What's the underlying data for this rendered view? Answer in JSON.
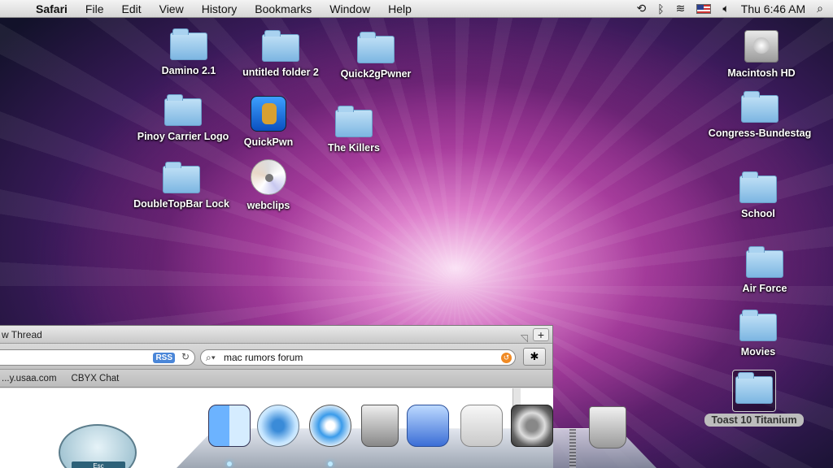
{
  "menubar": {
    "app_name": "Safari",
    "menus": [
      "File",
      "Edit",
      "View",
      "History",
      "Bookmarks",
      "Window",
      "Help"
    ],
    "clock": "Thu 6:46 AM"
  },
  "desktop_icons": [
    {
      "label": "Damino 2.1",
      "kind": "folder"
    },
    {
      "label": "untitled folder 2",
      "kind": "folder"
    },
    {
      "label": "Quick2gPwner",
      "kind": "folder"
    },
    {
      "label": "Macintosh HD",
      "kind": "drive"
    },
    {
      "label": "Pinoy Carrier Logo",
      "kind": "folder"
    },
    {
      "label": "QuickPwn",
      "kind": "app"
    },
    {
      "label": "The Killers",
      "kind": "folder"
    },
    {
      "label": "Congress-Bundestag",
      "kind": "folder"
    },
    {
      "label": "DoubleTopBar Lock",
      "kind": "folder"
    },
    {
      "label": "webclips",
      "kind": "disc"
    },
    {
      "label": "School",
      "kind": "folder"
    },
    {
      "label": "Air Force",
      "kind": "folder"
    },
    {
      "label": "Movies",
      "kind": "folder"
    },
    {
      "label": "Toast 10 Titanium",
      "kind": "folder",
      "selected": true
    }
  ],
  "safari": {
    "title": "w Thread",
    "rss_label": "RSS",
    "search_value": "mac rumors forum",
    "bookmarks": [
      "...y.usaa.com",
      "CBYX Chat"
    ]
  },
  "widget": {
    "key_label": "Esc"
  },
  "dock": {
    "apps": [
      "finder-icon",
      "itunes-icon",
      "safari-icon",
      "bin-icon",
      "word-icon",
      "toast-icon",
      "system-preferences-icon"
    ],
    "trash": "trash-icon"
  }
}
